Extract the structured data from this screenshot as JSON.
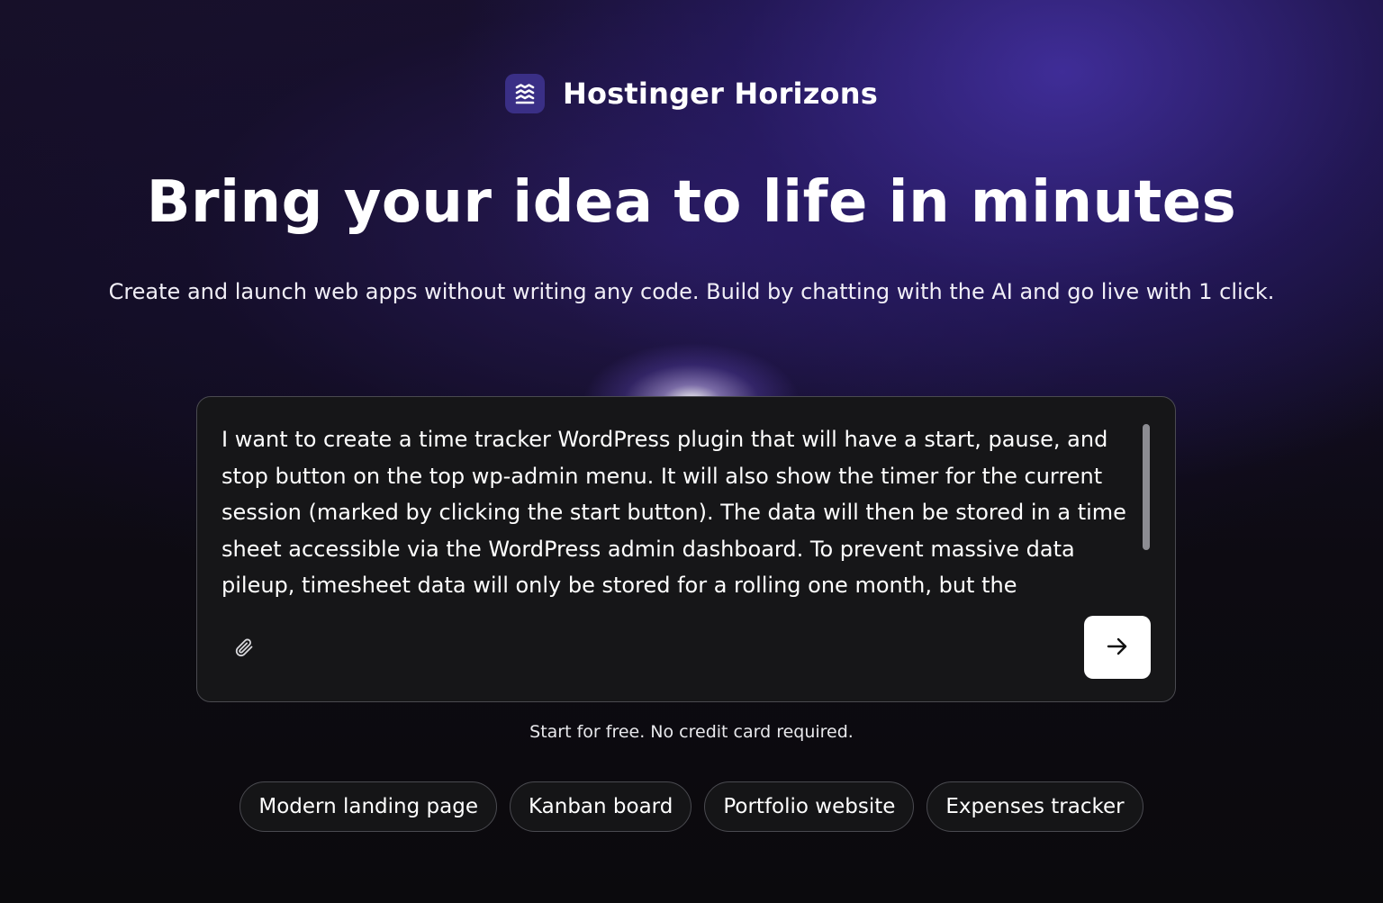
{
  "brand": {
    "name": "Hostinger Horizons",
    "logo_icon": "horizons-waves-icon"
  },
  "hero": {
    "headline": "Bring your idea to life in minutes",
    "subheadline": "Create and launch web apps without writing any code. Build by chatting with the AI and go live with 1 click."
  },
  "prompt": {
    "text": "I want to create a time tracker WordPress plugin that will have a start, pause, and stop button on the top wp-admin menu. It will also show the timer for the current session (marked by clicking the start button). The data will then be stored in a time sheet accessible via the WordPress admin dashboard. To prevent massive data pileup, timesheet data will only be stored for a rolling one month, but the",
    "attach_icon": "paperclip-icon",
    "send_icon": "arrow-right-icon"
  },
  "note": "Start for free. No credit card required.",
  "suggestions": [
    "Modern landing page",
    "Kanban board",
    "Portfolio website",
    "Expenses tracker"
  ],
  "colors": {
    "brand_logo_bg": "#3a2f86",
    "box_bg": "#161618",
    "box_border": "#4a4a50",
    "send_button_bg": "#ffffff"
  }
}
